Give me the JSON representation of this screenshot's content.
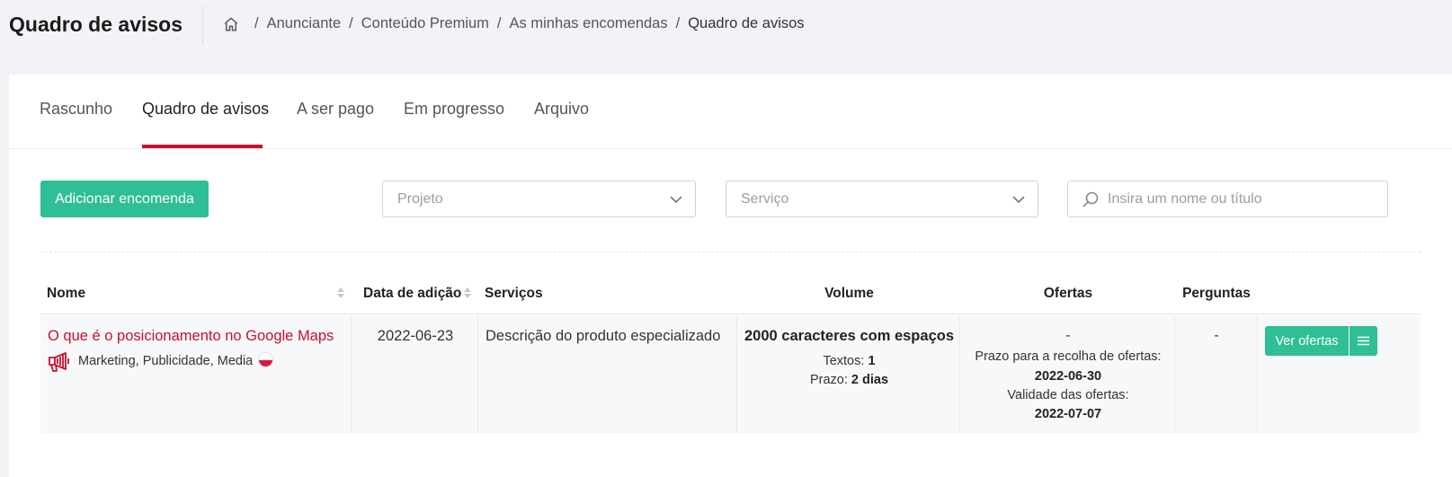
{
  "header": {
    "title": "Quadro de avisos",
    "breadcrumb": [
      "Anunciante",
      "Conteúdo Premium",
      "As minhas encomendas",
      "Quadro de avisos"
    ]
  },
  "tabs": [
    {
      "label": "Rascunho",
      "active": false
    },
    {
      "label": "Quadro de avisos",
      "active": true
    },
    {
      "label": "A ser pago",
      "active": false
    },
    {
      "label": "Em progresso",
      "active": false
    },
    {
      "label": "Arquivo",
      "active": false
    }
  ],
  "toolbar": {
    "add_label": "Adicionar encomenda",
    "project_placeholder": "Projeto",
    "service_placeholder": "Serviço",
    "search_placeholder": "Insira um nome ou título"
  },
  "table": {
    "columns": [
      "Nome",
      "Data de adição",
      "Serviços",
      "Volume",
      "Ofertas",
      "Perguntas"
    ],
    "rows": [
      {
        "name": "O que é o posicionamento no Google Maps",
        "category": "Marketing, Publicidade, Media",
        "date": "2022-06-23",
        "service": "Descrição do produto especializado",
        "volume": "2000 caracteres com espaços",
        "texts_label": "Textos:",
        "texts_value": "1",
        "deadline_label": "Prazo:",
        "deadline_value": "2 dias",
        "offers": "-",
        "offers_collect_label": "Prazo para a recolha de ofertas:",
        "offers_collect_date": "2022-06-30",
        "offers_valid_label": "Validade das ofertas:",
        "offers_valid_date": "2022-07-07",
        "questions": "-",
        "view_label": "Ver ofertas"
      }
    ]
  },
  "colors": {
    "accent_green": "#2fbe96",
    "brand_red": "#c8102e"
  }
}
